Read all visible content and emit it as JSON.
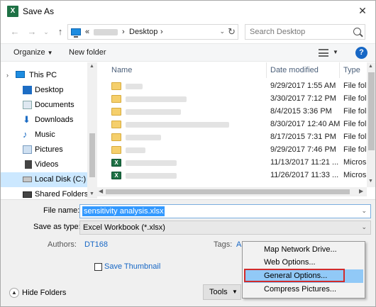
{
  "window": {
    "title": "Save As",
    "app_icon": "excel-icon"
  },
  "address": {
    "seg_root": "«",
    "seg_current": "Desktop",
    "seg_sep": "›",
    "dropdown": "⌄",
    "refresh": "↻"
  },
  "search": {
    "placeholder": "Search Desktop"
  },
  "toolbar": {
    "organize": "Organize",
    "new_folder": "New folder",
    "help": "?"
  },
  "navpane": {
    "items": [
      {
        "label": "This PC",
        "icon": "pc-icon"
      },
      {
        "label": "Desktop",
        "icon": "desktop-icon"
      },
      {
        "label": "Documents",
        "icon": "documents-icon"
      },
      {
        "label": "Downloads",
        "icon": "downloads-icon"
      },
      {
        "label": "Music",
        "icon": "music-icon"
      },
      {
        "label": "Pictures",
        "icon": "pictures-icon"
      },
      {
        "label": "Videos",
        "icon": "videos-icon"
      },
      {
        "label": "Local Disk (C:)",
        "icon": "disk-icon",
        "selected": true
      },
      {
        "label": "Shared Folders (\\",
        "icon": "shared-folder-icon"
      }
    ]
  },
  "filelist": {
    "columns": {
      "name": "Name",
      "date": "Date modified",
      "type": "Type"
    },
    "rows": [
      {
        "icon": "folder-icon",
        "date": "9/29/2017 1:55 AM",
        "type": "File fol"
      },
      {
        "icon": "folder-icon",
        "date": "3/30/2017 7:12 PM",
        "type": "File fol"
      },
      {
        "icon": "folder-icon",
        "date": "8/4/2015 3:36 PM",
        "type": "File fol"
      },
      {
        "icon": "folder-icon",
        "date": "8/30/2017 12:40 AM",
        "type": "File fol"
      },
      {
        "icon": "folder-icon",
        "date": "8/17/2015 7:31 PM",
        "type": "File fol"
      },
      {
        "icon": "folder-icon",
        "date": "9/29/2017 7:46 PM",
        "type": "File fol"
      },
      {
        "icon": "excel-file-icon",
        "date": "11/13/2017 11:21 ...",
        "type": "Micros"
      },
      {
        "icon": "excel-file-icon",
        "date": "11/26/2017 11:33 ...",
        "type": "Micros"
      }
    ]
  },
  "form": {
    "file_name_label": "File name:",
    "file_name_value": "sensitivity analysis.xlsx",
    "save_type_label": "Save as type:",
    "save_type_value": "Excel Workbook (*.xlsx)",
    "authors_label": "Authors:",
    "authors_value": "DT168",
    "tags_label": "Tags:",
    "tags_value": "A",
    "save_thumbnail": "Save Thumbnail"
  },
  "footer": {
    "hide_folders": "Hide Folders",
    "tools": "Tools"
  },
  "tools_menu": {
    "items": [
      "Map Network Drive...",
      "Web Options...",
      "General Options...",
      "Compress Pictures..."
    ],
    "highlighted": 2
  },
  "colors": {
    "accent": "#1767c5",
    "selection": "#3399ff",
    "highlight_border": "#d12b2b",
    "excel_green": "#1e7145"
  }
}
